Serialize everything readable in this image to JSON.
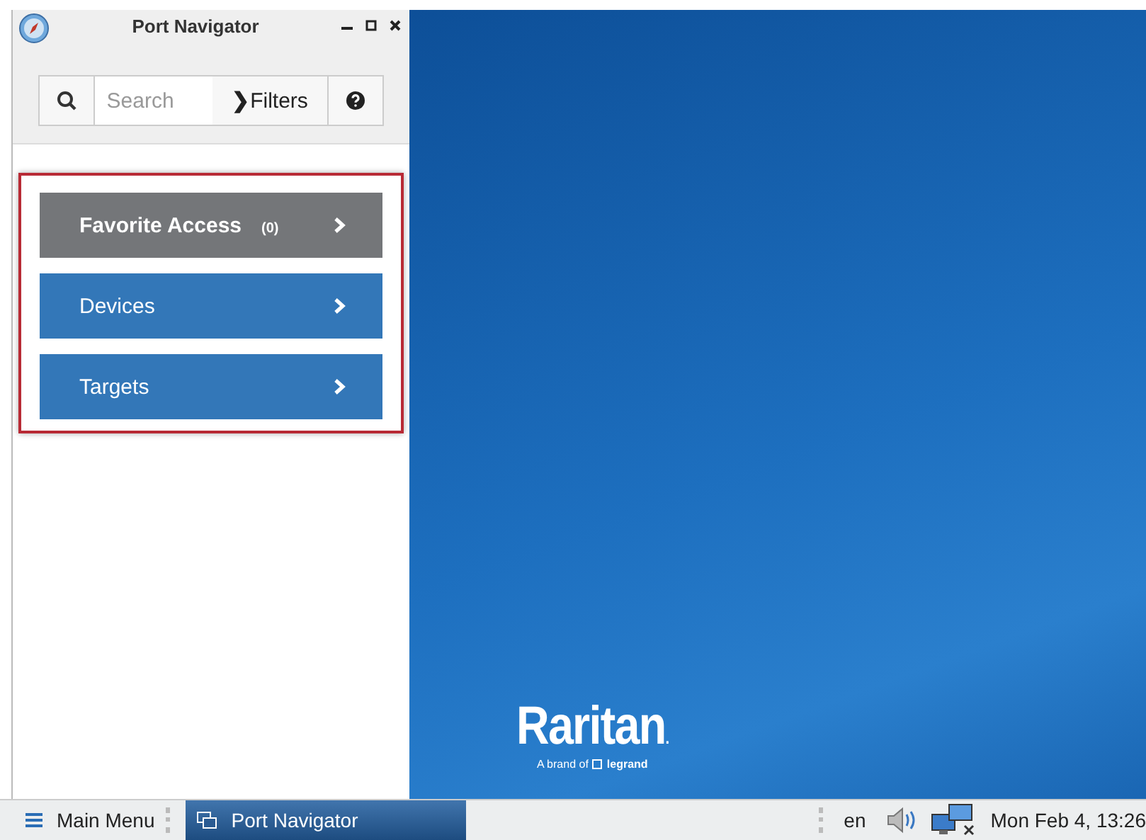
{
  "window": {
    "title": "Port Navigator"
  },
  "toolbar": {
    "search": {
      "placeholder": "Search"
    },
    "filters": {
      "icon": "❯",
      "label": "Filters"
    }
  },
  "menu": [
    {
      "label": "Favorite Access",
      "count": "(0)",
      "selected": true
    },
    {
      "label": "Devices",
      "selected": false
    },
    {
      "label": "Targets",
      "selected": false
    }
  ],
  "desktop": {
    "logo": "Raritan",
    "logo_mark": ".",
    "tagline": "A brand of",
    "brand": "legrand"
  },
  "taskbar": {
    "menu_label": "Main Menu",
    "tasks": [
      {
        "label": "Port Navigator",
        "selected": true
      }
    ],
    "language": "en",
    "clock": "Mon Feb  4, 13:26"
  }
}
